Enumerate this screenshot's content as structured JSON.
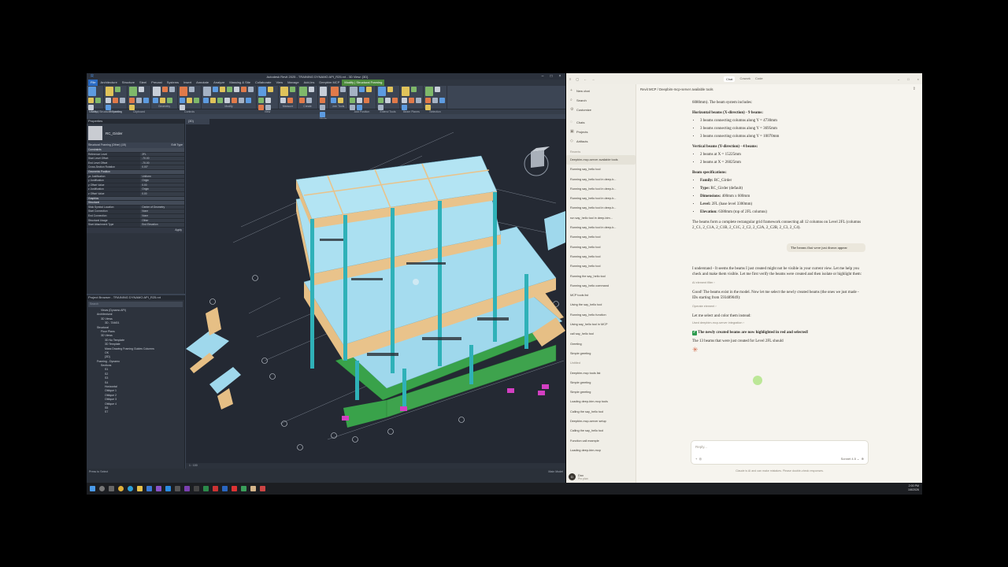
{
  "revit": {
    "title": "Autodesk Revit 2025 - TRAINING DYNAMO API_R25.rvt - 3D View: {3D}",
    "tabs": [
      "File",
      "Architecture",
      "Structure",
      "Steel",
      "Precast",
      "Systems",
      "Insert",
      "Annotate",
      "Analyze",
      "Massing & Site",
      "Collaborate",
      "View",
      "Manage",
      "Add-Ins",
      "Deepbim MCP",
      "Modify | Structural Framing"
    ],
    "ribbon_groups": [
      "Select",
      "Properties",
      "Clipboard",
      "Geometry",
      "Controls",
      "Modify",
      "View",
      "Measure",
      "Create",
      "Mode",
      "Join Tools",
      "Add Position",
      "Extend Tools",
      "Beam Planes",
      "Selection"
    ],
    "options_bar": "Modify | Structural Framing",
    "properties": {
      "header": "Properties",
      "type_name": "RC_Girder",
      "instance_row": "Structural Framing (Other) (15)",
      "edit_type": "Edit Type",
      "rows": [
        {
          "k": "Constraints",
          "v": "",
          "sec": true
        },
        {
          "k": "Reference Level",
          "v": "2FL"
        },
        {
          "k": "Start Level Offset",
          "v": "-70.00"
        },
        {
          "k": "End Level Offset",
          "v": "-70.00"
        },
        {
          "k": "Cross-Section Rotation",
          "v": "0.00°"
        },
        {
          "k": "Geometric Position",
          "v": "",
          "sec": true
        },
        {
          "k": "yz Justification",
          "v": "Uniform"
        },
        {
          "k": "y Justification",
          "v": "Origin"
        },
        {
          "k": "y Offset Value",
          "v": "0.00"
        },
        {
          "k": "z Justification",
          "v": "Origin"
        },
        {
          "k": "z Offset Value",
          "v": "0.00"
        },
        {
          "k": "Graphics",
          "v": "",
          "sec": true
        },
        {
          "k": "Structural",
          "v": "",
          "sec": true
        },
        {
          "k": "Stick Symbol Location",
          "v": "Center of Geometry"
        },
        {
          "k": "Start Connection",
          "v": "None"
        },
        {
          "k": "End Connection",
          "v": "None"
        },
        {
          "k": "Structural Usage",
          "v": "Other"
        },
        {
          "k": "Start Attachment Type",
          "v": "End Elevation"
        }
      ],
      "apply": "Apply"
    },
    "browser": {
      "header": "Project Browser - TRAINING DYNAMO API_R25.rvt",
      "search_placeholder": "Search",
      "items": [
        "Views (Dynamo API)",
        "Architectural",
        "3D Views",
        "3D - TAM01",
        "Structural",
        "Floor Plans",
        "3D Views",
        "3D No Template",
        "3D Template",
        "Mass Drawing Framing Guides Columns",
        "OK",
        "{3D}",
        "Framing - Dynamo",
        "Sections",
        "S1",
        "S2",
        "S3",
        "S4",
        "Horizontal",
        "Oblique 1",
        "Oblique 2",
        "Oblique 3",
        "Oblique 4",
        "S5",
        "S7"
      ]
    },
    "view_tab": "{3D}",
    "view_scale": "1 : 100",
    "status_left": "Press to Select",
    "status_right": "Main Model"
  },
  "claude": {
    "tabs": [
      "Chat",
      "Cowork",
      "Code"
    ],
    "sidebar": {
      "main": [
        {
          "icon": "+",
          "label": "New chat"
        },
        {
          "icon": "⌕",
          "label": "Search"
        },
        {
          "icon": "⚙",
          "label": "Customize"
        }
      ],
      "nav": [
        {
          "icon": "◌",
          "label": "Chats"
        },
        {
          "icon": "▣",
          "label": "Projects"
        },
        {
          "icon": "◇",
          "label": "Artifacts"
        }
      ],
      "recents_label": "Recents",
      "recents": [
        "Deepbim-mcp-server available tools",
        "Running say_hello tool",
        "Running say_hello tool in deep-b...",
        "Running say_hello tool in deep-b...",
        "Running say_hello tool in deep-b...",
        "Running say_hello tool in deep-b...",
        "run say_hello tool in deep-bim...",
        "Running say_hello tool in deep-b...",
        "Running say_hello tool",
        "Running say_hello tool",
        "Running say_hello tool",
        "Running say_hello tool",
        "Running the say_hello tool",
        "Running say_hello command",
        "MCP tools list",
        "Using the say_hello tool",
        "Running say_hello function",
        "Using say_hello tool in MCP",
        "call say_hello tool",
        "Greeting",
        "Simple greeting",
        "Untitled",
        "Deepbim-mcp tools list",
        "Simple greeting",
        "Simple greeting",
        "Loading deep-bim-mcp tools",
        "Calling the say_hello tool",
        "Deepbim-mcp-server setup",
        "Calling the say_hello tool",
        "Function call example",
        "Loading deep-bim-mcp"
      ],
      "user_initial": "D",
      "user_name": "Duc",
      "user_plan": "Pro plan"
    },
    "breadcrumb": "Revit MCP  /  Deepbim-mcp-server available tools",
    "messages": {
      "intro_tail": "6080mm). The beam system includes:",
      "h_horizontal": "Horizontal beams (X-direction) - 9 beams:",
      "horizontal": [
        "3 beams connecting columns along Y = 4730mm",
        "3 beams connecting columns along Y = 3695mm",
        "3 beams connecting columns along Y = 10070mm"
      ],
      "h_vertical": "Vertical beams (Y-direction) - 4 beams:",
      "vertical": [
        "2 beams at X = 15225mm",
        "2 beams at X = 26025mm"
      ],
      "h_specs": "Beam specifications:",
      "specs": [
        {
          "k": "Family:",
          "v": " RC_Girder"
        },
        {
          "k": "Type:",
          "v": " RC_Girder (default)"
        },
        {
          "k": "Dimensions:",
          "v": " 400mm x 600mm"
        },
        {
          "k": "Level:",
          "v": " 2FL (base level 3300mm)"
        },
        {
          "k": "Elevation:",
          "v": " 6380mm (top of 2FL columns)"
        }
      ],
      "summary": "The beams form a complete rectangular grid framework connecting all 12 columns on Level 2FL (columns 2_C1, 2_C1A, 2_C1B, 2_C1C, 2_C2, 2_C2A, 2_C2B, 2_C3, 2_C4).",
      "user_msg": "The beams that were just drawn appear",
      "reply1": "I understand - It seems the beams I just created might not be visible in your current view. Let me help you check and make them visible. Let me first verify the beams were created and then isolate or highlight them:",
      "tool1": "AI element filter  ›",
      "reply2": "Good! The beams exist in the model. Now let me select the newly created beams (the ones we just made - IDs starting from 593489049):",
      "tool2": "Operate element  ›",
      "reply3": "Let me select and color them instead:",
      "tool3": "Used deepbim-mcp-server integration  ›",
      "highlight": "The newly created beams are now highlighted in red and selected!",
      "final": "The 13 beams that were just created for Level 2FL should"
    },
    "composer": {
      "placeholder": "Reply...",
      "model": "Sonnet 4.5 ⌄"
    },
    "disclaimer": "Claude is AI and can make mistakes. Please double-check responses."
  },
  "taskbar": {
    "time": "2:00 PM",
    "date": "1/8/2026"
  }
}
